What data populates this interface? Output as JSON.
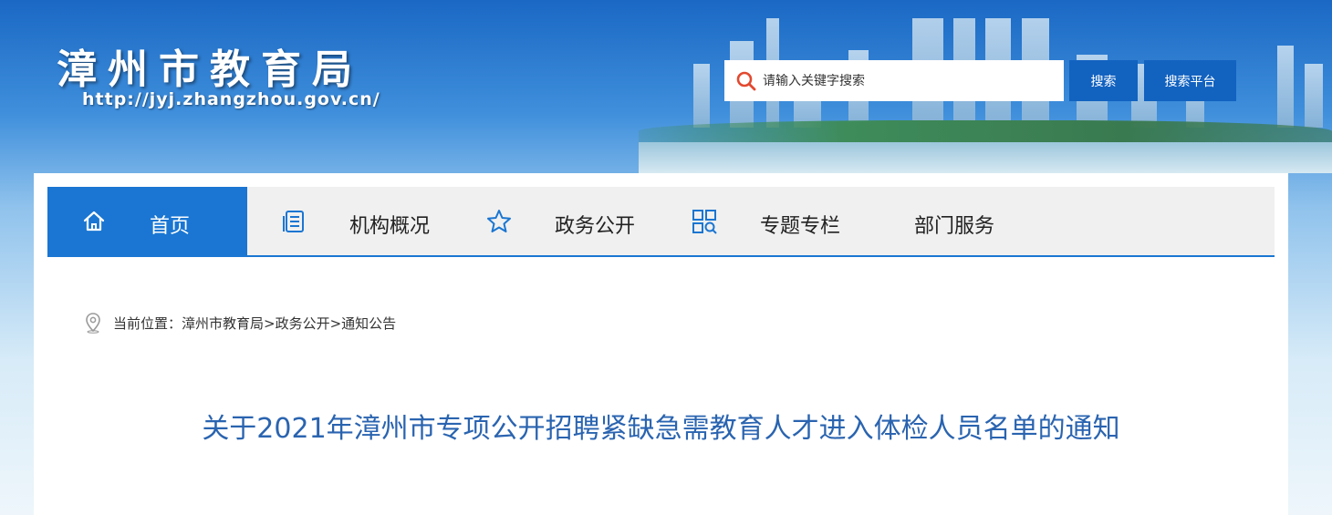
{
  "header": {
    "site_title": "漳州市教育局",
    "site_url": "http://jyj.zhangzhou.gov.cn/",
    "search": {
      "placeholder": "请输入关键字搜索",
      "search_button": "搜索",
      "platform_button": "搜索平台"
    }
  },
  "nav": {
    "items": [
      {
        "label": "首页",
        "icon": "home-icon",
        "active": true
      },
      {
        "label": "机构概况",
        "icon": "document-list-icon",
        "active": false
      },
      {
        "label": "政务公开",
        "icon": "star-icon",
        "active": false
      },
      {
        "label": "专题专栏",
        "icon": "grid-search-icon",
        "active": false
      },
      {
        "label": "部门服务",
        "icon": "",
        "active": false
      }
    ]
  },
  "breadcrumb": {
    "prefix": "当前位置：",
    "path": "漳州市教育局>政务公开>通知公告"
  },
  "article": {
    "title": "关于2021年漳州市专项公开招聘紧缺急需教育人才进入体检人员名单的通知"
  },
  "colors": {
    "accent": "#1a76d2",
    "button": "#1262c0",
    "title": "#2a64b0"
  }
}
